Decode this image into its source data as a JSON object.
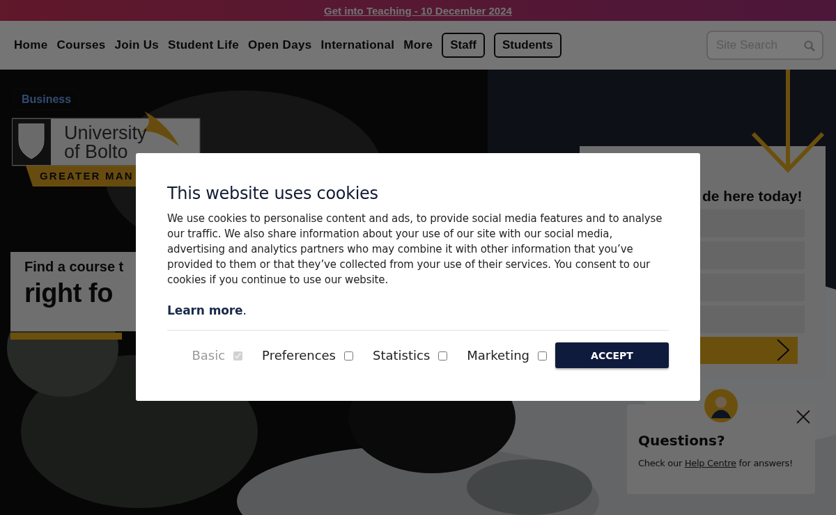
{
  "banner": {
    "text": "Get into Teaching - 10 December 2024"
  },
  "nav": {
    "items": [
      "Home",
      "Courses",
      "Join Us",
      "Student Life",
      "Open Days",
      "International",
      "More"
    ],
    "buttons": [
      "Staff",
      "Students"
    ],
    "search": {
      "placeholder": "Site Search"
    }
  },
  "hero": {
    "tag": "Business",
    "logo": {
      "line1": "University",
      "line2": "of Bolto",
      "band": "GREATER MAN"
    },
    "course_card": {
      "line1": "Find a course t",
      "line2": "right fo"
    },
    "form": {
      "heading": "de here today!"
    }
  },
  "modal": {
    "title": "This website uses cookies",
    "body": "We use cookies to personalise content and ads, to provide social media features and to analyse our traffic. We also share information about your use of our site with our social media, advertising and analytics partners who may combine it with other information that you’ve provided to them or that they’ve collected from your use of their services. You consent to our cookies if you continue to use our website.",
    "learn_more": {
      "link": "Learn more",
      "after": "."
    },
    "options": [
      {
        "label": "Basic",
        "checked": true,
        "disabled": true
      },
      {
        "label": "Preferences",
        "checked": false,
        "disabled": false
      },
      {
        "label": "Statistics",
        "checked": false,
        "disabled": false
      },
      {
        "label": "Marketing",
        "checked": false,
        "disabled": false
      }
    ],
    "accept": "ACCEPT"
  },
  "chat": {
    "title": "Questions?",
    "before": "Check our ",
    "link": "Help Centre",
    "after": " for answers!"
  }
}
